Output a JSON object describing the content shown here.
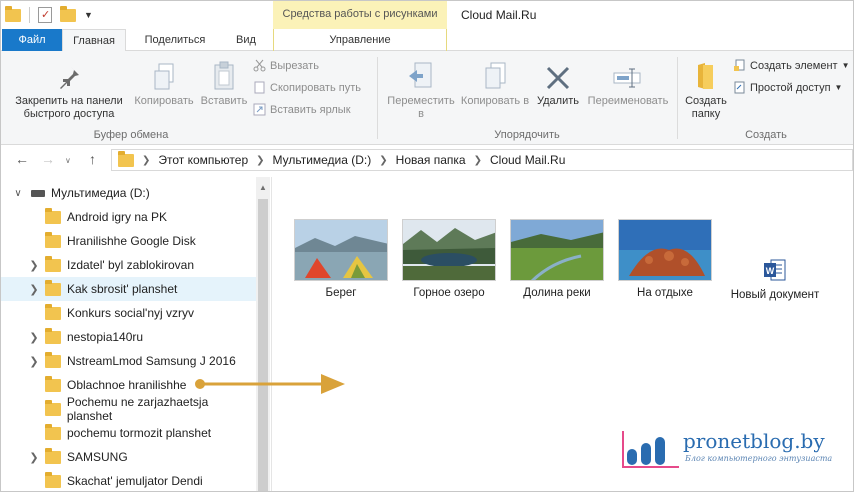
{
  "window": {
    "title": "Cloud Mail.Ru",
    "contextual_tab_group": "Средства работы с рисунками"
  },
  "tabs": {
    "file": "Файл",
    "home": "Главная",
    "share": "Поделиться",
    "view": "Вид",
    "manage": "Управление"
  },
  "ribbon": {
    "clipboard": {
      "label": "Буфер обмена",
      "pin": "Закрепить на панели быстрого доступа",
      "copy": "Копировать",
      "paste": "Вставить",
      "cut": "Вырезать",
      "copy_path": "Скопировать путь",
      "paste_shortcut": "Вставить ярлык"
    },
    "organize": {
      "label": "Упорядочить",
      "move_to": "Переместить в",
      "copy_to": "Копировать в",
      "delete": "Удалить",
      "rename": "Переименовать"
    },
    "create": {
      "label": "Создать",
      "new_folder": "Создать папку",
      "new_item": "Создать элемент",
      "easy_access": "Простой доступ"
    }
  },
  "address": {
    "path": [
      "Этот компьютер",
      "Мультимедиа (D:)",
      "Новая папка",
      "Cloud Mail.Ru"
    ]
  },
  "navpane": {
    "drive": "Мультимедиа (D:)",
    "folders": [
      {
        "name": "Android igry na PK",
        "expandable": false,
        "selected": false
      },
      {
        "name": "Hranilishhe Google Disk",
        "expandable": false,
        "selected": false
      },
      {
        "name": "Izdatel' byl zablokirovan",
        "expandable": true,
        "selected": false
      },
      {
        "name": "Kak sbrosit' planshet",
        "expandable": true,
        "selected": true
      },
      {
        "name": "Konkurs social'nyj vzryv",
        "expandable": false,
        "selected": false
      },
      {
        "name": "nestopia140ru",
        "expandable": true,
        "selected": false
      },
      {
        "name": "NstreamLmod Samsung J 2016",
        "expandable": true,
        "selected": false
      },
      {
        "name": "Oblachnoe hranilishhe",
        "expandable": false,
        "selected": false
      },
      {
        "name": "Pochemu ne zarjazhaetsja planshet",
        "expandable": false,
        "selected": false
      },
      {
        "name": "pochemu tormozit planshet",
        "expandable": false,
        "selected": false
      },
      {
        "name": "SAMSUNG",
        "expandable": true,
        "selected": false
      },
      {
        "name": "Skachat' jemuljator Dendi",
        "expandable": false,
        "selected": false
      }
    ]
  },
  "content": {
    "items": [
      {
        "name": "Берег",
        "kind": "image-shore"
      },
      {
        "name": "Горное озеро",
        "kind": "image-lake"
      },
      {
        "name": "Долина реки",
        "kind": "image-valley"
      },
      {
        "name": "На отдыхе",
        "kind": "image-rest"
      },
      {
        "name": "Новый документ",
        "kind": "word-doc-icon"
      }
    ]
  },
  "watermark": {
    "title": "pronetblog.by",
    "subtitle": "Блог компьютерного энтузиаста"
  },
  "colors": {
    "file_tab": "#1979ca",
    "tools_tab": "#fbf2b8",
    "arrow": "#d9a23a",
    "selection": "#e5f3fb",
    "folder": "#f2c44f"
  }
}
